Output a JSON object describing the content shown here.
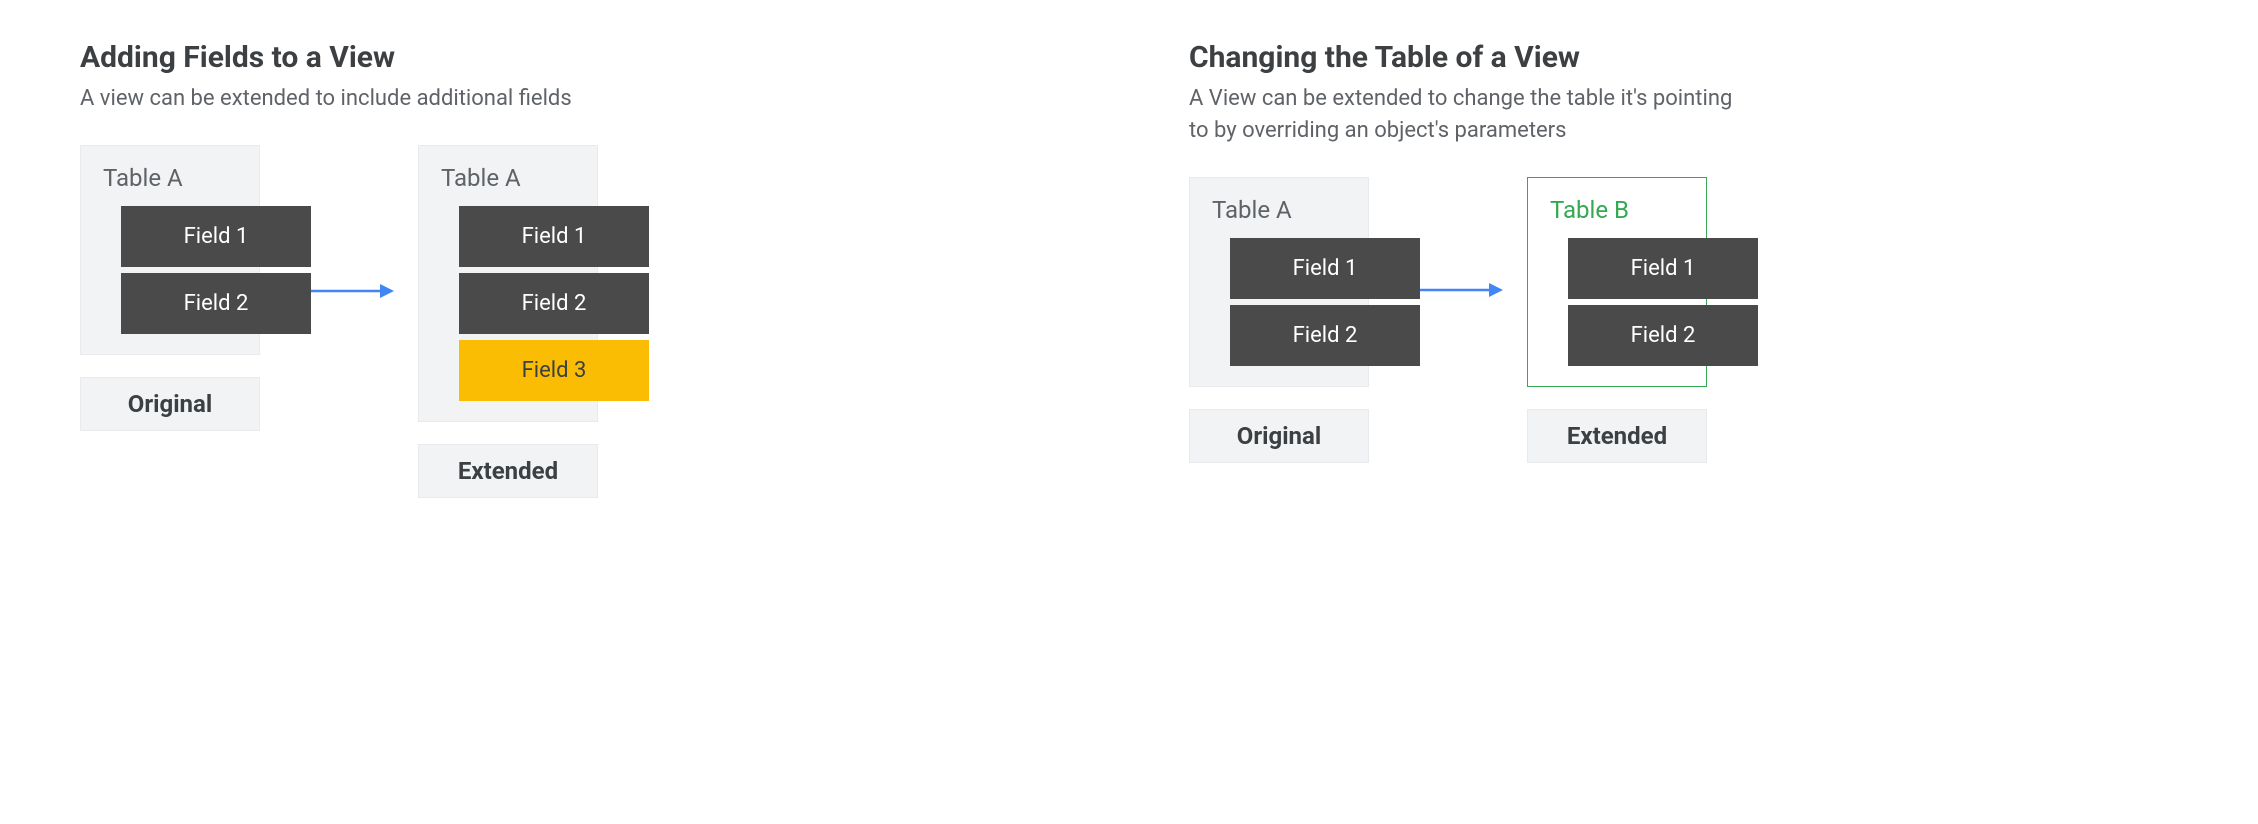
{
  "left": {
    "title": "Adding Fields to a View",
    "subtitle": "A view can be extended to include additional fields",
    "original": {
      "table_label": "Table A",
      "fields": {
        "f1": "Field 1",
        "f2": "Field 2"
      },
      "caption": "Original"
    },
    "extended": {
      "table_label": "Table A",
      "fields": {
        "f1": "Field 1",
        "f2": "Field 2",
        "f3": "Field 3"
      },
      "caption": "Extended"
    }
  },
  "right": {
    "title": "Changing the Table of a View",
    "subtitle": "A View can be extended to change the table it's pointing to by overriding an object's parameters",
    "original": {
      "table_label": "Table A",
      "fields": {
        "f1": "Field 1",
        "f2": "Field 2"
      },
      "caption": "Original"
    },
    "extended": {
      "table_label": "Table B",
      "fields": {
        "f1": "Field 1",
        "f2": "Field 2"
      },
      "caption": "Extended"
    }
  }
}
